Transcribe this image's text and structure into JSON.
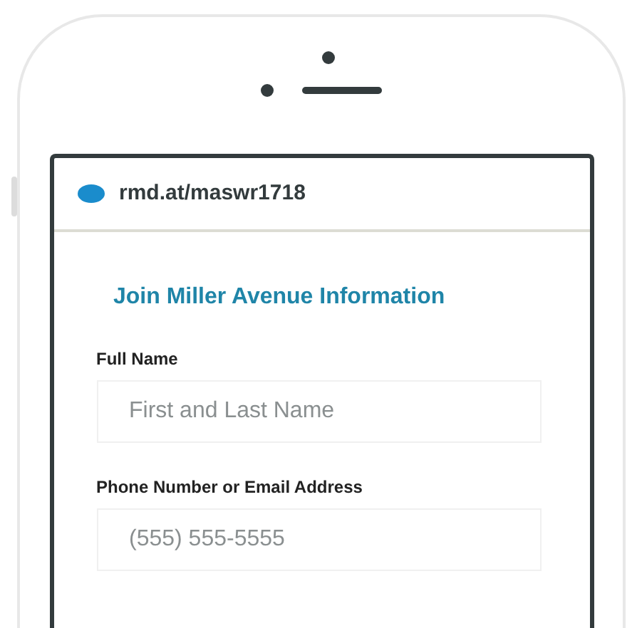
{
  "browser": {
    "url": "rmd.at/maswr1718"
  },
  "form": {
    "title": "Join Miller Avenue Information",
    "fields": [
      {
        "label": "Full Name",
        "placeholder": "First and Last Name"
      },
      {
        "label": "Phone Number or Email Address",
        "placeholder": "(555) 555-5555"
      }
    ]
  }
}
